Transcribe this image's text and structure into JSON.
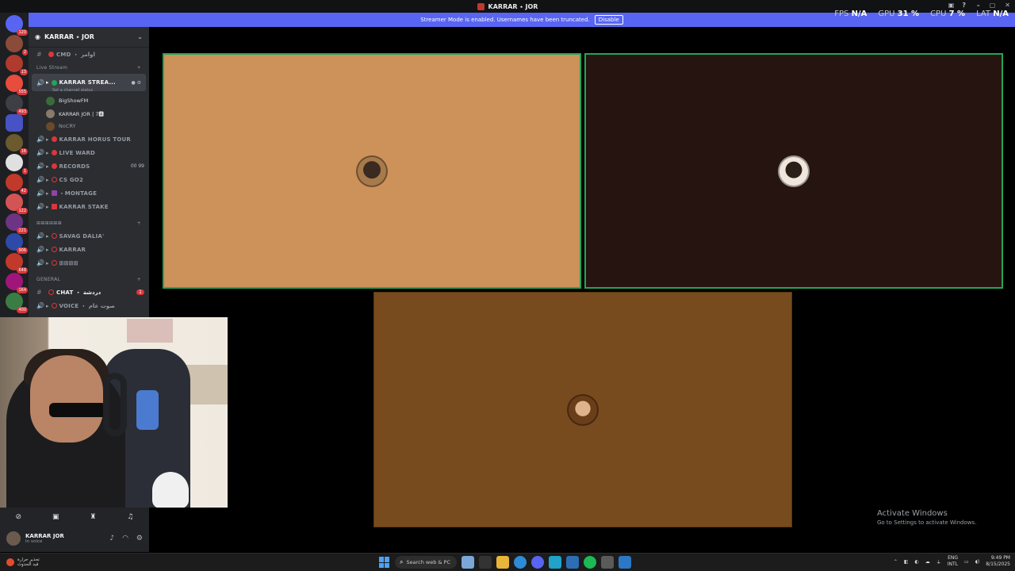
{
  "window": {
    "title": "KARRAR ٭ JOR"
  },
  "banner": {
    "message": "Streamer Mode is enabled. Usernames have been truncated.",
    "disable_label": "Disable"
  },
  "perf": [
    {
      "label": "FPS",
      "value": "N/A"
    },
    {
      "label": "GPU",
      "value": "31 %"
    },
    {
      "label": "CPU",
      "value": "7 %"
    },
    {
      "label": "LAT",
      "value": "N/A"
    }
  ],
  "rail_badges": [
    "120",
    "2",
    "13",
    "555",
    "493",
    "",
    "16",
    "1",
    "42",
    "122",
    "221",
    "906",
    "648",
    "164",
    "400"
  ],
  "server": {
    "name": "KARRAR ٭ JOR"
  },
  "channels": {
    "cmd": {
      "name": "CMD ・ اوامر"
    },
    "live_stream_cat": "Live Stream",
    "stream": {
      "name": "KARRAR STREA...",
      "status": "Set a channel status"
    },
    "users": [
      {
        "name": "BigShowFM"
      },
      {
        "name": "KARRAR JOR | 7🅰"
      },
      {
        "name": "NoCRY"
      }
    ],
    "voice": [
      {
        "name": "KARRAR HORUS TOUR",
        "extra": ""
      },
      {
        "name": "LIVE WARD",
        "extra": ""
      },
      {
        "name": "RECORDS",
        "extra": "00   99"
      },
      {
        "name": "CS GO2",
        "extra": ""
      },
      {
        "name": "・MONTAGE",
        "extra": ""
      },
      {
        "name": "KARRAR STAKE",
        "extra": ""
      }
    ],
    "cat2": "⊞⊞⊞⊞⊞⊞",
    "voice2": [
      {
        "name": "SAVAG DALIA'"
      },
      {
        "name": "KARRAR"
      },
      {
        "name": "⊞⊞⊞⊞"
      }
    ],
    "general_cat": "GENERAL",
    "chat": {
      "name": "CHAT ・ دردشة",
      "count": "1"
    },
    "voice_last": {
      "name": "VOICE ・ صوت عام"
    }
  },
  "user_panel": {
    "name": "KARRAR JOR",
    "status": "In voice"
  },
  "activate": {
    "line1": "Activate Windows",
    "line2": "Go to Settings to activate Windows."
  },
  "taskbar": {
    "weather_line1": "تحذير حرارة",
    "weather_line2": "قيد الحدوث",
    "search_placeholder": "Search web & PC",
    "lang_line1": "ENG",
    "lang_line2": "INTL",
    "time": "9:49 PM",
    "date": "8/15/2025"
  },
  "colors": {
    "tile1": "#cd915a",
    "tile2": "#251410",
    "tile3": "#774b1e",
    "speaking": "#23a55a",
    "blurple": "#5865f2"
  }
}
